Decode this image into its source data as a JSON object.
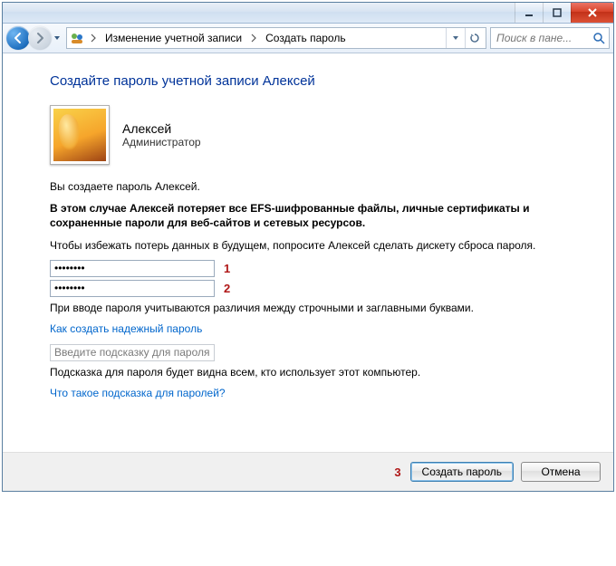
{
  "breadcrumb": {
    "seg1": "Изменение учетной записи",
    "seg2": "Создать пароль"
  },
  "search": {
    "placeholder": "Поиск в пане..."
  },
  "page": {
    "title": "Создайте пароль учетной записи Алексей"
  },
  "user": {
    "name": "Алексей",
    "role": "Администратор"
  },
  "text": {
    "creating": "Вы создаете пароль Алексей.",
    "warning": "В этом случае Алексей потеряет все EFS-шифрованные файлы, личные сертификаты и сохраненные пароли для веб-сайтов и сетевых ресурсов.",
    "floppy": "Чтобы избежать потерь данных в будущем, попросите Алексей сделать дискету сброса пароля.",
    "case_note": "При вводе пароля учитываются различия между строчными и заглавными буквами.",
    "link_strong": "Как создать надежный пароль",
    "hint_placeholder": "Введите подсказку для пароля",
    "hint_note": "Подсказка для пароля будет видна всем, кто использует этот компьютер.",
    "link_hint": "Что такое подсказка для паролей?"
  },
  "inputs": {
    "pwd1": "••••••••",
    "pwd2": "••••••••"
  },
  "annotations": {
    "a1": "1",
    "a2": "2",
    "a3": "3"
  },
  "buttons": {
    "create": "Создать пароль",
    "cancel": "Отмена"
  }
}
